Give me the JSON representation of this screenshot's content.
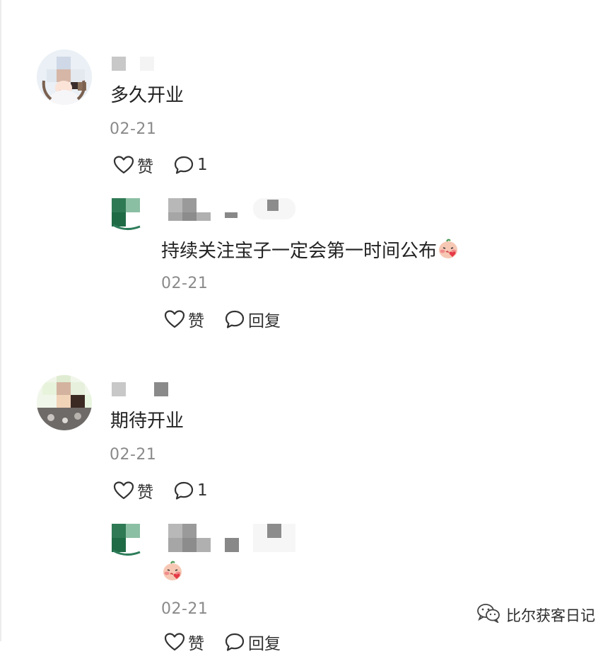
{
  "comments": [
    {
      "text": "多久开业",
      "date": "02-21",
      "like_label": "赞",
      "reply_count": "1",
      "reply": {
        "text": "持续关注宝子一定会第一时间公布",
        "emoji": "blushing-face-emoji",
        "date": "02-21",
        "like_label": "赞",
        "reply_label": "回复"
      }
    },
    {
      "text": "期待开业",
      "date": "02-21",
      "like_label": "赞",
      "reply_count": "1",
      "reply": {
        "text": "",
        "emoji": "blushing-face-emoji",
        "date": "02-21",
        "like_label": "赞",
        "reply_label": "回复"
      }
    }
  ],
  "watermark": {
    "text": "比尔获客日记",
    "icon": "wechat-icon"
  },
  "colors": {
    "text": "#222222",
    "meta": "#8a8a8a",
    "brand_green": "#2e7d5a"
  }
}
